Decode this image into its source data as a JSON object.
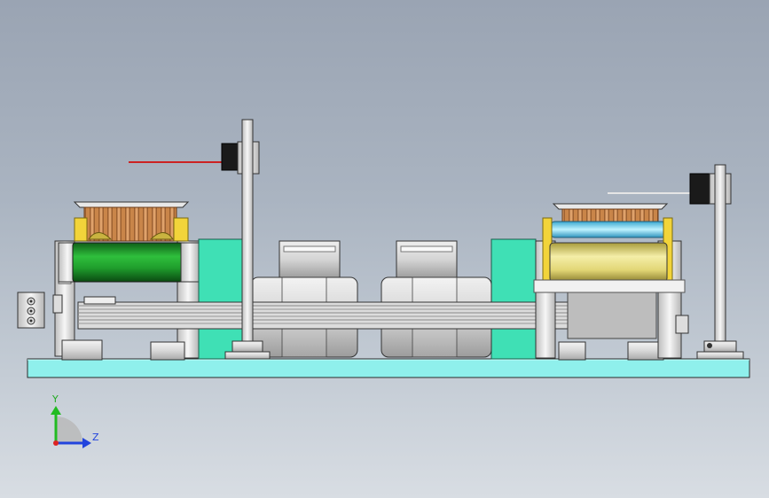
{
  "viewport": {
    "colors": {
      "background_top": "#9aa4b3",
      "background_bottom": "#d8dde3",
      "base_plate": "#8ff0ec",
      "green_roller": "#1f9d2c",
      "yellow_roller": "#e9e08a",
      "cyan_rod": "#6ad6f0",
      "copper_fins": "#d9935a",
      "teal_bracket": "#3fe0b5",
      "laser": "#cc2222"
    }
  },
  "triad": {
    "y_label": "Y",
    "z_label": "Z",
    "colors": {
      "y_axis": "#22bb22",
      "z_axis": "#2244dd",
      "origin": "#dd2222"
    }
  }
}
